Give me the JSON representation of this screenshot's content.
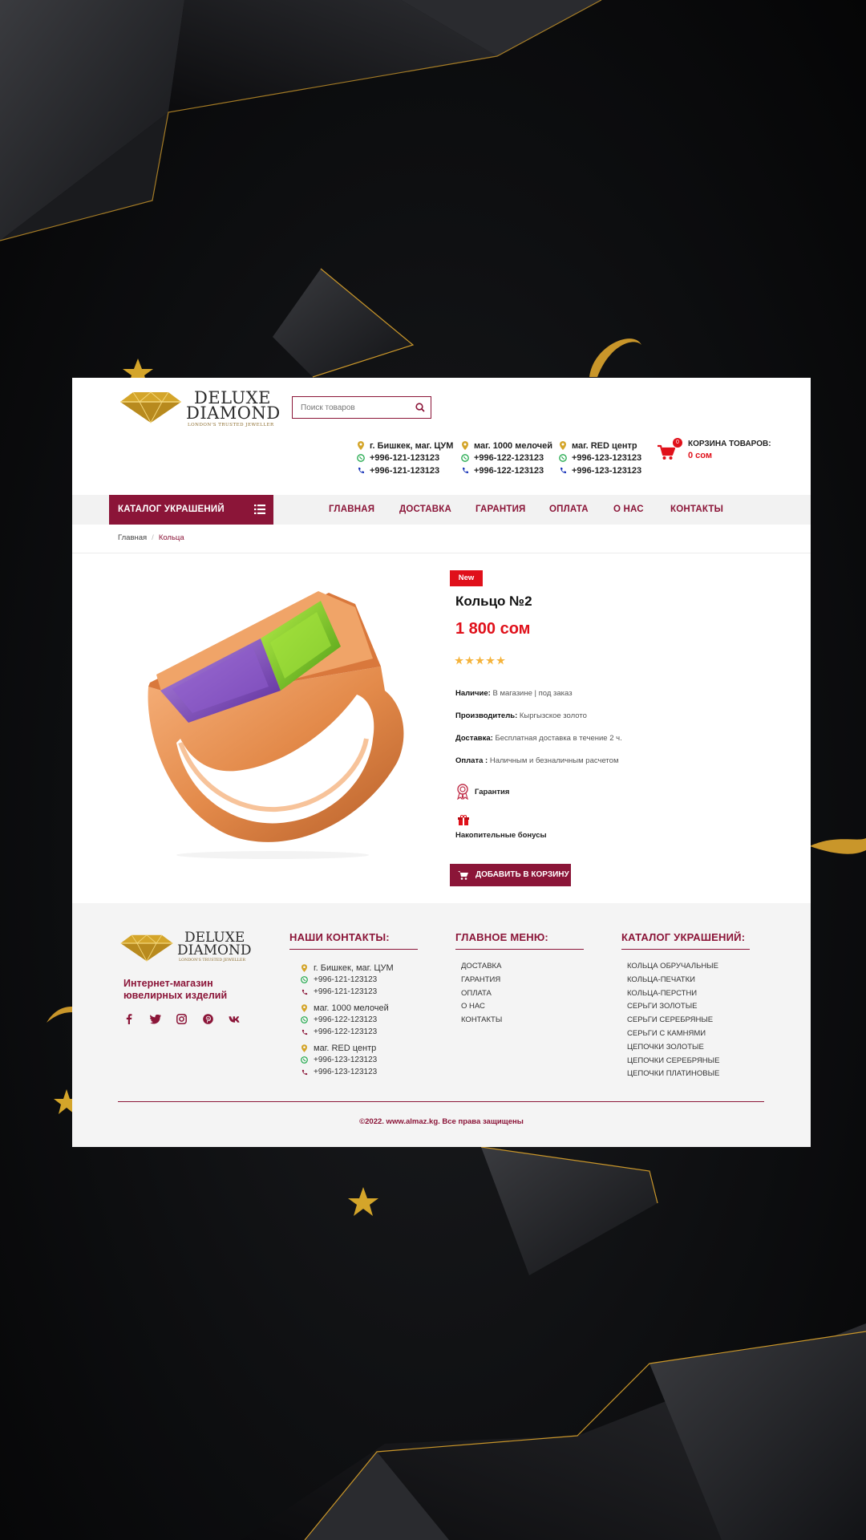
{
  "brand": {
    "name_line1": "DELUXE",
    "name_line2": "DIAMOND",
    "tagline": "LONDON'S TRUSTED JEWELLER"
  },
  "search": {
    "placeholder": "Поиск товаров",
    "icon": "search-icon"
  },
  "stores": [
    {
      "address": "г. Бишкек, маг. ЦУМ",
      "whatsapp": "+996-121-123123",
      "phone": "+996-121-123123"
    },
    {
      "address": "маг. 1000 мелочей",
      "whatsapp": "+996-122-123123",
      "phone": "+996-122-123123"
    },
    {
      "address": "маг. RED центр",
      "whatsapp": "+996-123-123123",
      "phone": "+996-123-123123"
    }
  ],
  "cart": {
    "count": "0",
    "label": "КОРЗИНА ТОВАРОВ:",
    "sum": "0 сом"
  },
  "nav": {
    "catalog_label": "КАТАЛОГ УКРАШЕНИЙ",
    "items": [
      "ГЛАВНАЯ",
      "ДОСТАВКА",
      "ГАРАНТИЯ",
      "ОПЛАТА",
      "О НАС",
      "КОНТАКТЫ"
    ]
  },
  "breadcrumb": {
    "home": "Главная",
    "current": "Кольца"
  },
  "product": {
    "badge": "New",
    "title": "Кольцо №2",
    "price": "1 800 сом",
    "rating": 5,
    "specs": [
      {
        "label": "Наличие:",
        "value": "В магазине | под заказ"
      },
      {
        "label": "Производитель:",
        "value": "Кыргызское золото"
      },
      {
        "label": "Доставка:",
        "value": "Бесплатная доставка в течение 2 ч."
      },
      {
        "label": "Оплата :",
        "value": "Наличным и безналичным расчетом"
      }
    ],
    "guarantee": "Гарантия",
    "bonuses": "Накопительные бонусы",
    "add_to_cart": "ДОБАВИТЬ В КОРЗИНУ"
  },
  "footer": {
    "tagline": "Интернет-магазин ювелирных изделий",
    "socials": [
      "facebook-icon",
      "twitter-icon",
      "instagram-icon",
      "pinterest-icon",
      "vk-icon"
    ],
    "contacts_title": "НАШИ КОНТАКТЫ:",
    "menu_title": "ГЛАВНОЕ МЕНЮ:",
    "menu_items": [
      "ДОСТАВКА",
      "ГАРАНТИЯ",
      "ОПЛАТА",
      "О НАС",
      "КОНТАКТЫ"
    ],
    "catalog_title": "КАТАЛОГ УКРАШЕНИЙ:",
    "catalog_items": [
      "КОЛЬЦА ОБРУЧАЛЬНЫЕ",
      "КОЛЬЦА-ПЕЧАТКИ",
      "КОЛЬЦА-ПЕРСТНИ",
      "СЕРЬГИ ЗОЛОТЫЕ",
      "СЕРЬГИ СЕРЕБРЯНЫЕ",
      "СЕРЬГИ С КАМНЯМИ",
      "ЦЕПОЧКИ ЗОЛОТЫЕ",
      "ЦЕПОЧКИ СЕРЕБРЯНЫЕ",
      "ЦЕПОЧКИ ПЛАТИНОВЫЕ"
    ],
    "copyright": "©2022. www.almaz.kg. Все права защищены"
  },
  "colors": {
    "brand": "#8b1538",
    "accent": "#e0101a",
    "gold": "#d4a52a"
  }
}
